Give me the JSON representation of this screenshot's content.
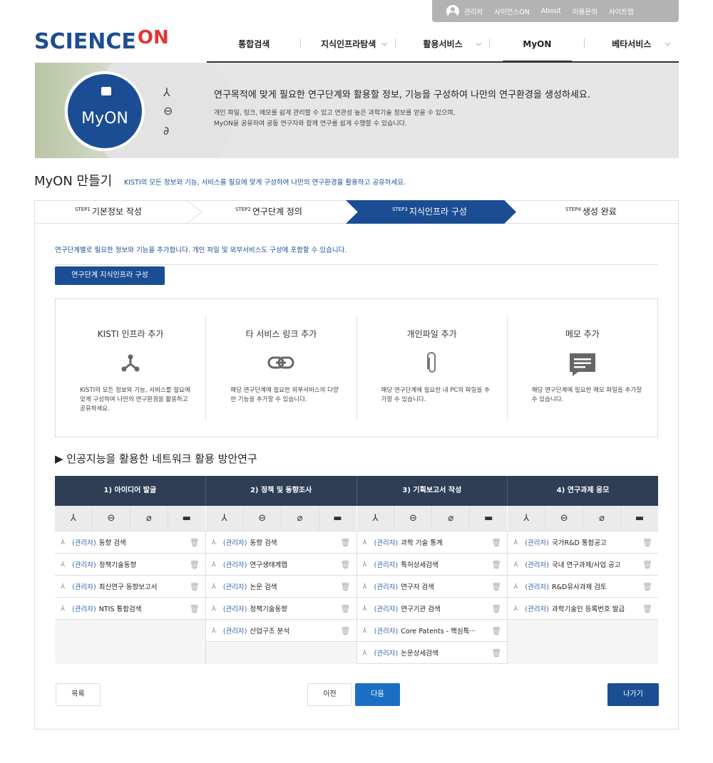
{
  "util": {
    "admin": "관리자",
    "links": [
      "사이언스ON",
      "About",
      "이용문의",
      "사이트맵"
    ]
  },
  "logo": {
    "sci": "SCIENCE",
    "on": "ON"
  },
  "gnb": [
    {
      "label": "통합검색",
      "dropdown": false
    },
    {
      "label": "지식인프라탐색",
      "dropdown": true
    },
    {
      "label": "활용서비스",
      "dropdown": true
    },
    {
      "label": "MyON",
      "dropdown": false,
      "active": true
    },
    {
      "label": "베타서비스",
      "dropdown": true
    }
  ],
  "banner": {
    "circle": "MyON",
    "headline": "연구목적에 맞게 필요한 연구단계와 활용할 정보, 기능을 구성하여 나만의 연구환경을 생성하세요.",
    "line1": "개인 파일, 링크, 메모를 쉽게 관리할 수 있고 연관성 높은 과학기술 정보를 얻을 수 있으며,",
    "line2": "MyON을 공유하여 공동 연구자와 함께 연구를 쉽게 수행할 수 있습니다."
  },
  "page": {
    "title": "MyON 만들기",
    "subtitle": "KISTI의 모든 정보와 기능, 서비스를 필요에 맞게 구성하여 나만의 연구환경을 활용하고 공유하세요."
  },
  "steps": [
    {
      "num": "STEP1",
      "label": "기본정보 작성"
    },
    {
      "num": "STEP2",
      "label": "연구단계 정의"
    },
    {
      "num": "STEP3",
      "label": "지식인프라 구성",
      "active": true
    },
    {
      "num": "STEP4",
      "label": "생성 완료"
    }
  ],
  "desc": "연구단계별로 필요한 정보와 기능을 추가합니다. 개인 파일 및 외부서비스도 구성에 포함할 수 있습니다.",
  "tab": "연구단계 지식인프라 구성",
  "cards": [
    {
      "title": "KISTI 인프라 추가",
      "icon": "network-icon",
      "desc": "KISTI의 모든 정보와 기능, 서비스를 필요에 맞게 구성하여 나만의 연구환경을 활용하고 공유하세요."
    },
    {
      "title": "타 서비스 링크 추가",
      "icon": "link-icon",
      "desc": "해당 연구단계에 필요한 외부서비스의 다양한 기능을 추가할 수 있습니다."
    },
    {
      "title": "개인파일 추가",
      "icon": "paperclip-icon",
      "desc": "해당 연구단계에 필요한 내 PC의 파일을 추가할 수 있습니다."
    },
    {
      "title": "메모 추가",
      "icon": "memo-icon",
      "desc": "해당 연구단계에 필요한 메모 파일을 추가할 수 있습니다."
    }
  ],
  "section": "▶ 인공지능을 활용한 네트워크 활용 방안연구",
  "grid": {
    "admin_tag": "(관리자)",
    "columns": [
      {
        "title": "1) 아이디어 발굴",
        "items": [
          "동향 검색",
          "정책기술동향",
          "최신연구 동향보고서",
          "NTIS 통합검색"
        ]
      },
      {
        "title": "2) 정책 및 동향조사",
        "items": [
          "동향 검색",
          "연구생태계맵",
          "논문 검색",
          "정책기술동향",
          "산업구조 분석"
        ]
      },
      {
        "title": "3) 기획보고서 작성",
        "items": [
          "과학 기술 통계",
          "특허상세검색",
          "연구자 검색",
          "연구기관 검색",
          "Core Patents - 핵심특···",
          "논문상세검색"
        ]
      },
      {
        "title": "4) 연구과제 응모",
        "items": [
          "국가R&D 통합공고",
          "국내 연구과제/사업 공고",
          "R&D유사과제 검토",
          "과학기술인 등록번호 발급"
        ]
      }
    ]
  },
  "buttons": {
    "list": "목록",
    "prev": "이전",
    "next": "다음",
    "exit": "나가기"
  },
  "colors": {
    "brand": "#1a4d94",
    "accent": "#e3342f",
    "grid_header": "#2d3e55",
    "link": "#3360a8"
  }
}
